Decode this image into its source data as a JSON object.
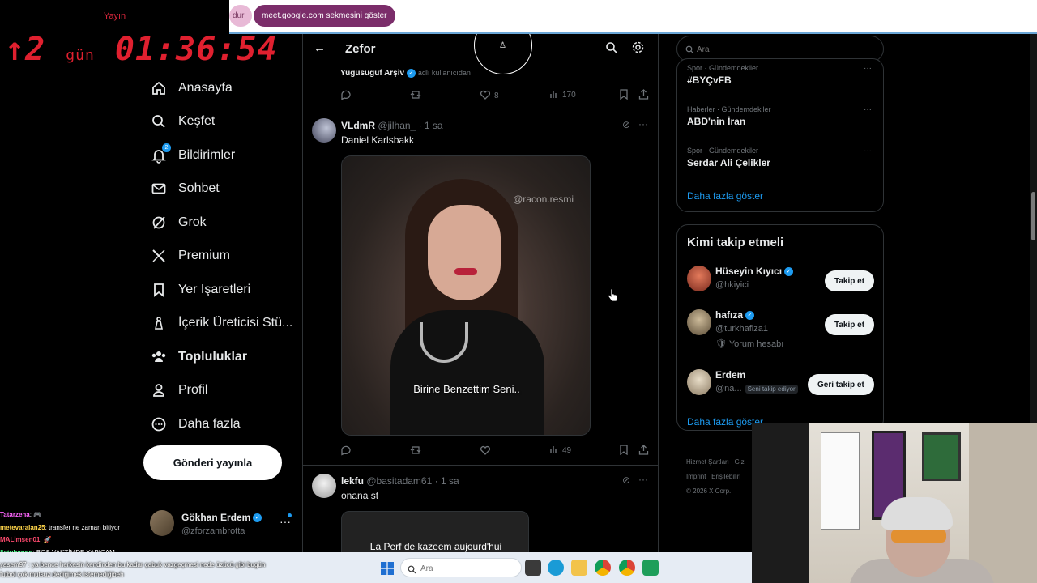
{
  "browser": {
    "tab_fragment": "dur",
    "notice_pill": "meet.google.com sekmesini göster"
  },
  "stream_timer": {
    "top_label": "Yayın",
    "arrow": "↑",
    "days_value": "2",
    "days_unit": "gün",
    "time": "01:36:54"
  },
  "nav": {
    "items": [
      {
        "label": "Anasayfa",
        "icon": "home-icon"
      },
      {
        "label": "Keşfet",
        "icon": "search-icon"
      },
      {
        "label": "Bildirimler",
        "icon": "bell-icon",
        "badge": "2"
      },
      {
        "label": "Sohbet",
        "icon": "mail-icon"
      },
      {
        "label": "Grok",
        "icon": "grok-icon"
      },
      {
        "label": "Premium",
        "icon": "x-logo-icon"
      },
      {
        "label": "Yer İşaretleri",
        "icon": "bookmark-icon"
      },
      {
        "label": "İçerik Üreticisi Stü...",
        "icon": "creator-studio-icon"
      },
      {
        "label": "Topluluklar",
        "icon": "communities-icon"
      },
      {
        "label": "Profil",
        "icon": "profile-icon"
      },
      {
        "label": "Daha fazla",
        "icon": "more-circle-icon"
      }
    ],
    "post_button": "Gönderi yayınla"
  },
  "account": {
    "name": "Gökhan Erdem",
    "handle": "@zforzambrotta"
  },
  "main": {
    "title": "Zefor",
    "repost": {
      "name": "Yugusuguf Arşiv",
      "sub": "adlı kullanıcıdan"
    },
    "first_actions": {
      "likes": "8",
      "views": "170"
    },
    "tweets": [
      {
        "name": "VLdmR",
        "handle": "@jilhan_",
        "time": "· 1 sa",
        "text": "Daniel Karlsbakk",
        "media_watermark": "@racon.resmi",
        "media_caption": "Birine Benzettim Seni..",
        "views": "49"
      },
      {
        "name": "lekfu",
        "handle": "@basitadam61",
        "time": "· 1 sa",
        "text": "onana st",
        "media_caption": "La Perf de kazeem aujourd'hui"
      }
    ]
  },
  "right": {
    "search_placeholder": "Ara",
    "trends": [
      {
        "category": "Spor · Gündemdekiler",
        "title": "#BYÇvFB"
      },
      {
        "category": "Haberler · Gündemdekiler",
        "title": "ABD'nin İran"
      },
      {
        "category": "Spor · Gündemdekiler",
        "title": "Serdar Ali Çelikler"
      }
    ],
    "trends_show_more": "Daha fazla göster",
    "follow_title": "Kimi takip etmeli",
    "suggestions": [
      {
        "name": "Hüseyin Kıyıcı",
        "handle": "@hkiyici",
        "button": "Takip et",
        "verified": true
      },
      {
        "name": "hafıza",
        "handle": "@turkhafiza1",
        "extra": "🛡 Yorum hesabı",
        "button": "Takip et",
        "verified": true
      },
      {
        "name": "Erdem",
        "handle": "@na...",
        "tag": "Seni takip ediyor",
        "button": "Geri takip et",
        "verified": false
      }
    ],
    "follow_show_more": "Daha fazla göster",
    "footer": [
      "Hizmet Şartları",
      "Gizl",
      "Imprint",
      "Erişilebilirl",
      "© 2026 X Corp."
    ]
  },
  "chat": {
    "lines": [
      {
        "user": "Tatarzena",
        "msg": ": 🎮",
        "color": "#ff66ff"
      },
      {
        "user": "metevaralan25",
        "msg": ": transfer ne zaman bitiyor",
        "color": "#ffd54a"
      },
      {
        "user": "MALİmsen01",
        "msg": ": 🚀",
        "color": "#ff4a6e"
      },
      {
        "user": "8atuhannn",
        "msg": ": BOŞ VAKTİMDE YAPICAM",
        "color": "#4aff8a"
      }
    ],
    "overlay": "yasem97 : ya bence herkesin kendinden bu kadar çabuk vazgeçmesi nede üzücü gibi bugün futbol çok mutsuz dediğimek istemediğibeh"
  },
  "taskbar": {
    "search_placeholder": "Ara"
  }
}
